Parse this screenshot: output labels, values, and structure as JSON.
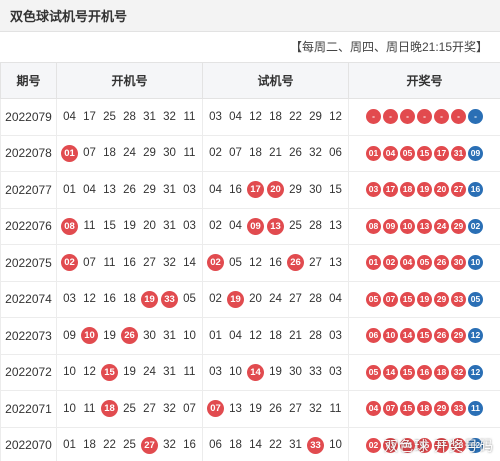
{
  "title": "双色球试机号开机号",
  "subtitle": "【每周二、周四、周日晚21:15开奖】",
  "columns": [
    "期号",
    "开机号",
    "试机号",
    "开奖号"
  ],
  "colors": {
    "hit": "#e14b4f",
    "red_ball": "#e24a4e",
    "blue_ball": "#2a6fb5"
  },
  "rows": [
    {
      "issue": "2022079",
      "kaiji": [
        {
          "n": "04"
        },
        {
          "n": "17"
        },
        {
          "n": "25"
        },
        {
          "n": "28"
        },
        {
          "n": "31"
        },
        {
          "n": "32"
        },
        {
          "n": "11"
        }
      ],
      "shiji": [
        {
          "n": "03"
        },
        {
          "n": "04"
        },
        {
          "n": "12"
        },
        {
          "n": "18"
        },
        {
          "n": "22"
        },
        {
          "n": "29"
        },
        {
          "n": "12"
        }
      ],
      "draw": [
        {
          "n": "-"
        },
        {
          "n": "-"
        },
        {
          "n": "-"
        },
        {
          "n": "-"
        },
        {
          "n": "-"
        },
        {
          "n": "-"
        },
        {
          "n": "-",
          "blue": true
        }
      ]
    },
    {
      "issue": "2022078",
      "kaiji": [
        {
          "n": "01",
          "hit": true
        },
        {
          "n": "07"
        },
        {
          "n": "18"
        },
        {
          "n": "24"
        },
        {
          "n": "29"
        },
        {
          "n": "30"
        },
        {
          "n": "11"
        }
      ],
      "shiji": [
        {
          "n": "02"
        },
        {
          "n": "07"
        },
        {
          "n": "18"
        },
        {
          "n": "21"
        },
        {
          "n": "26"
        },
        {
          "n": "32"
        },
        {
          "n": "06"
        }
      ],
      "draw": [
        {
          "n": "01"
        },
        {
          "n": "04"
        },
        {
          "n": "05"
        },
        {
          "n": "15"
        },
        {
          "n": "17"
        },
        {
          "n": "31"
        },
        {
          "n": "09",
          "blue": true
        }
      ]
    },
    {
      "issue": "2022077",
      "kaiji": [
        {
          "n": "01"
        },
        {
          "n": "04"
        },
        {
          "n": "13"
        },
        {
          "n": "26"
        },
        {
          "n": "29"
        },
        {
          "n": "31"
        },
        {
          "n": "03"
        }
      ],
      "shiji": [
        {
          "n": "04"
        },
        {
          "n": "16"
        },
        {
          "n": "17",
          "hit": true
        },
        {
          "n": "20",
          "hit": true
        },
        {
          "n": "29"
        },
        {
          "n": "30"
        },
        {
          "n": "15"
        }
      ],
      "draw": [
        {
          "n": "03"
        },
        {
          "n": "17"
        },
        {
          "n": "18"
        },
        {
          "n": "19"
        },
        {
          "n": "20"
        },
        {
          "n": "27"
        },
        {
          "n": "16",
          "blue": true
        }
      ]
    },
    {
      "issue": "2022076",
      "kaiji": [
        {
          "n": "08",
          "hit": true
        },
        {
          "n": "11"
        },
        {
          "n": "15"
        },
        {
          "n": "19"
        },
        {
          "n": "20"
        },
        {
          "n": "31"
        },
        {
          "n": "03"
        }
      ],
      "shiji": [
        {
          "n": "02"
        },
        {
          "n": "04"
        },
        {
          "n": "09",
          "hit": true
        },
        {
          "n": "13",
          "hit": true
        },
        {
          "n": "25"
        },
        {
          "n": "28"
        },
        {
          "n": "13"
        }
      ],
      "draw": [
        {
          "n": "08"
        },
        {
          "n": "09"
        },
        {
          "n": "10"
        },
        {
          "n": "13"
        },
        {
          "n": "24"
        },
        {
          "n": "29"
        },
        {
          "n": "02",
          "blue": true
        }
      ]
    },
    {
      "issue": "2022075",
      "kaiji": [
        {
          "n": "02",
          "hit": true
        },
        {
          "n": "07"
        },
        {
          "n": "11"
        },
        {
          "n": "16"
        },
        {
          "n": "27"
        },
        {
          "n": "32"
        },
        {
          "n": "14"
        }
      ],
      "shiji": [
        {
          "n": "02",
          "hit": true
        },
        {
          "n": "05"
        },
        {
          "n": "12"
        },
        {
          "n": "16"
        },
        {
          "n": "26",
          "hit": true
        },
        {
          "n": "27"
        },
        {
          "n": "13"
        }
      ],
      "draw": [
        {
          "n": "01"
        },
        {
          "n": "02"
        },
        {
          "n": "04"
        },
        {
          "n": "05"
        },
        {
          "n": "26"
        },
        {
          "n": "30"
        },
        {
          "n": "10",
          "blue": true
        }
      ]
    },
    {
      "issue": "2022074",
      "kaiji": [
        {
          "n": "03"
        },
        {
          "n": "12"
        },
        {
          "n": "16"
        },
        {
          "n": "18"
        },
        {
          "n": "19",
          "hit": true
        },
        {
          "n": "33",
          "hit": true
        },
        {
          "n": "05"
        }
      ],
      "shiji": [
        {
          "n": "02"
        },
        {
          "n": "19",
          "hit": true
        },
        {
          "n": "20"
        },
        {
          "n": "24"
        },
        {
          "n": "27"
        },
        {
          "n": "28"
        },
        {
          "n": "04"
        }
      ],
      "draw": [
        {
          "n": "05"
        },
        {
          "n": "07"
        },
        {
          "n": "15"
        },
        {
          "n": "19"
        },
        {
          "n": "29"
        },
        {
          "n": "33"
        },
        {
          "n": "05",
          "blue": true
        }
      ]
    },
    {
      "issue": "2022073",
      "kaiji": [
        {
          "n": "09"
        },
        {
          "n": "10",
          "hit": true
        },
        {
          "n": "19"
        },
        {
          "n": "26",
          "hit": true
        },
        {
          "n": "30"
        },
        {
          "n": "31"
        },
        {
          "n": "10"
        }
      ],
      "shiji": [
        {
          "n": "01"
        },
        {
          "n": "04"
        },
        {
          "n": "12"
        },
        {
          "n": "18"
        },
        {
          "n": "21"
        },
        {
          "n": "28"
        },
        {
          "n": "03"
        }
      ],
      "draw": [
        {
          "n": "06"
        },
        {
          "n": "10"
        },
        {
          "n": "14"
        },
        {
          "n": "15"
        },
        {
          "n": "26"
        },
        {
          "n": "29"
        },
        {
          "n": "12",
          "blue": true
        }
      ]
    },
    {
      "issue": "2022072",
      "kaiji": [
        {
          "n": "10"
        },
        {
          "n": "12"
        },
        {
          "n": "15",
          "hit": true
        },
        {
          "n": "19"
        },
        {
          "n": "24"
        },
        {
          "n": "31"
        },
        {
          "n": "11"
        }
      ],
      "shiji": [
        {
          "n": "03"
        },
        {
          "n": "10"
        },
        {
          "n": "14",
          "hit": true
        },
        {
          "n": "19"
        },
        {
          "n": "30"
        },
        {
          "n": "33"
        },
        {
          "n": "03"
        }
      ],
      "draw": [
        {
          "n": "05"
        },
        {
          "n": "14"
        },
        {
          "n": "15"
        },
        {
          "n": "16"
        },
        {
          "n": "18"
        },
        {
          "n": "32"
        },
        {
          "n": "12",
          "blue": true
        }
      ]
    },
    {
      "issue": "2022071",
      "kaiji": [
        {
          "n": "10"
        },
        {
          "n": "11"
        },
        {
          "n": "18",
          "hit": true
        },
        {
          "n": "25"
        },
        {
          "n": "27"
        },
        {
          "n": "32"
        },
        {
          "n": "07"
        }
      ],
      "shiji": [
        {
          "n": "07",
          "hit": true
        },
        {
          "n": "13"
        },
        {
          "n": "19"
        },
        {
          "n": "26"
        },
        {
          "n": "27"
        },
        {
          "n": "32"
        },
        {
          "n": "11"
        }
      ],
      "draw": [
        {
          "n": "04"
        },
        {
          "n": "07"
        },
        {
          "n": "15"
        },
        {
          "n": "18"
        },
        {
          "n": "29"
        },
        {
          "n": "33"
        },
        {
          "n": "11",
          "blue": true
        }
      ]
    },
    {
      "issue": "2022070",
      "kaiji": [
        {
          "n": "01"
        },
        {
          "n": "18"
        },
        {
          "n": "22"
        },
        {
          "n": "25"
        },
        {
          "n": "27",
          "hit": true
        },
        {
          "n": "32"
        },
        {
          "n": "16"
        }
      ],
      "shiji": [
        {
          "n": "06"
        },
        {
          "n": "18"
        },
        {
          "n": "14"
        },
        {
          "n": "22"
        },
        {
          "n": "31"
        },
        {
          "n": "33",
          "hit": true
        },
        {
          "n": "10"
        }
      ],
      "draw": [
        {
          "n": "02"
        },
        {
          "n": "03"
        },
        {
          "n": "06"
        },
        {
          "n": "15"
        },
        {
          "n": "27"
        },
        {
          "n": "28"
        },
        {
          "n": "02",
          "blue": true
        }
      ]
    }
  ],
  "watermark": "双色球 开奖号码"
}
